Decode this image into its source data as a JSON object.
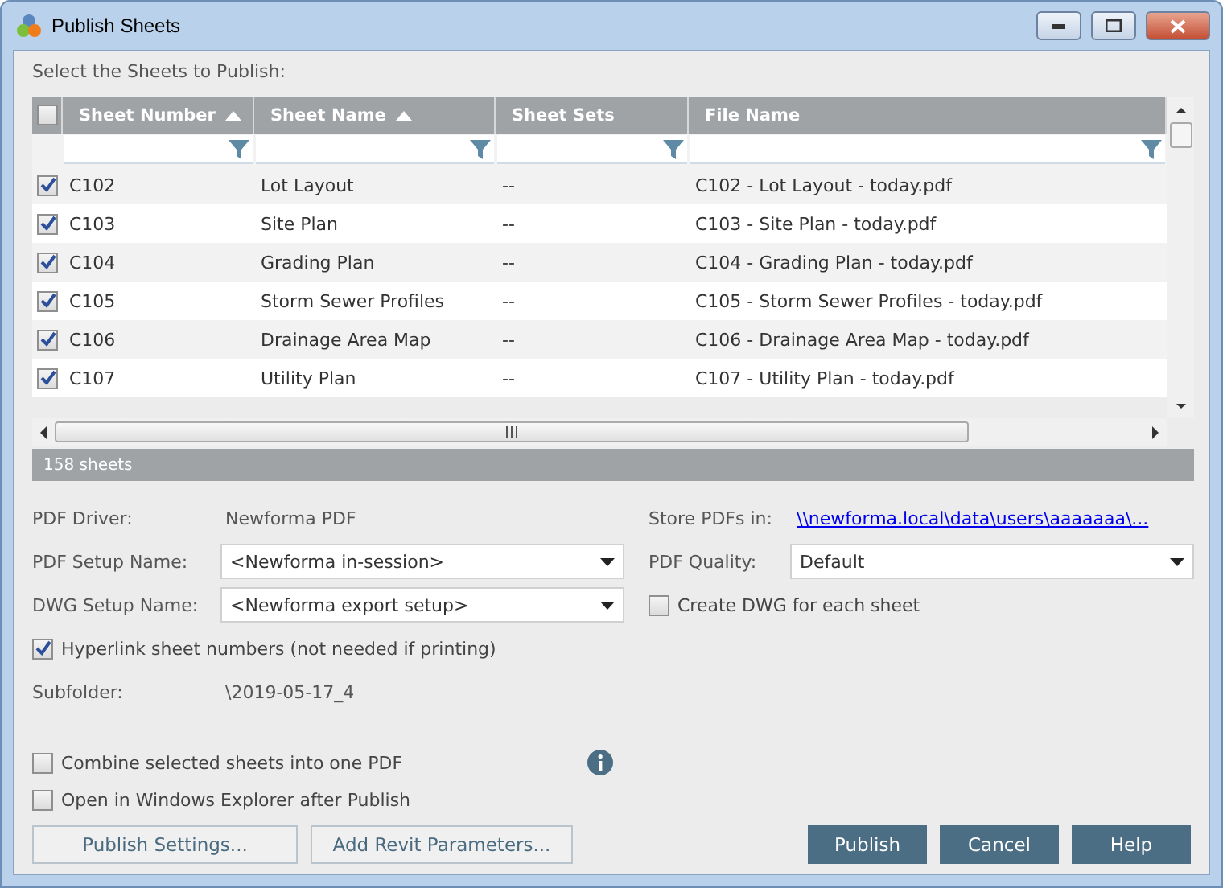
{
  "window": {
    "title": "Publish Sheets"
  },
  "prompt": "Select the Sheets to Publish:",
  "table": {
    "all_checked": false,
    "columns": [
      {
        "label": "Sheet Number",
        "sorted": true
      },
      {
        "label": "Sheet Name",
        "sorted": true
      },
      {
        "label": "Sheet Sets",
        "sorted": false
      },
      {
        "label": "File Name",
        "sorted": false
      }
    ],
    "rows": [
      {
        "checked": true,
        "cells": [
          "C102",
          "Lot Layout",
          "--",
          "C102 - Lot Layout -  today.pdf"
        ]
      },
      {
        "checked": true,
        "cells": [
          "C103",
          "Site Plan",
          "--",
          "C103 - Site Plan -  today.pdf"
        ]
      },
      {
        "checked": true,
        "cells": [
          "C104",
          "Grading Plan",
          "--",
          "C104 - Grading Plan -  today.pdf"
        ]
      },
      {
        "checked": true,
        "cells": [
          "C105",
          "Storm Sewer Profiles",
          "--",
          "C105 - Storm Sewer Profiles -  today.pdf"
        ]
      },
      {
        "checked": true,
        "cells": [
          "C106",
          "Drainage Area Map",
          "--",
          "C106 - Drainage Area Map -  today.pdf"
        ]
      },
      {
        "checked": true,
        "cells": [
          "C107",
          "Utility Plan",
          "--",
          "C107 - Utility Plan -  today.pdf"
        ]
      }
    ],
    "count": "158 sheets"
  },
  "pdf_driver": {
    "label": "PDF Driver:",
    "value": "Newforma PDF"
  },
  "pdf_setup": {
    "label": "PDF Setup Name:",
    "value": "<Newforma in-session>"
  },
  "dwg_setup": {
    "label": "DWG Setup Name:",
    "value": "<Newforma export setup>"
  },
  "hyperlink": {
    "label": "Hyperlink sheet numbers (not needed if printing)",
    "checked": true
  },
  "subfolder": {
    "label": "Subfolder:",
    "value": "\\2019-05-17_4"
  },
  "store": {
    "label": "Store PDFs in:",
    "value": "\\\\newforma.local\\data\\users\\aaaaaaa\\..."
  },
  "pdf_quality": {
    "label": "PDF Quality:",
    "value": "Default"
  },
  "create_dwg": {
    "label": "Create DWG for each sheet",
    "checked": false
  },
  "combine": {
    "label": "Combine selected sheets into one PDF",
    "checked": false
  },
  "open_explorer": {
    "label": "Open in Windows Explorer after Publish",
    "checked": false
  },
  "left_buttons": [
    "Publish Settings...",
    "Add Revit Parameters..."
  ],
  "right_buttons": [
    "Publish",
    "Cancel",
    "Help"
  ]
}
